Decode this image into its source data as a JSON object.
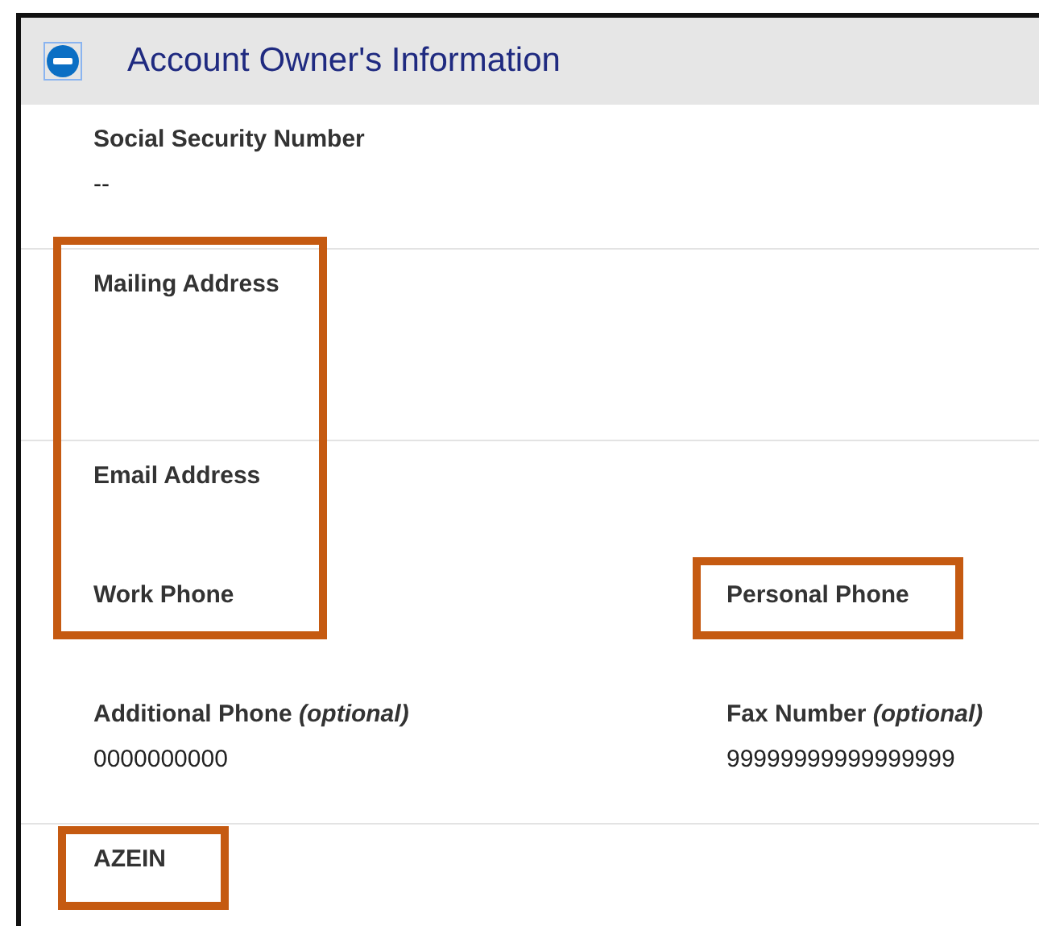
{
  "panel": {
    "title": "Account Owner's Information",
    "expanded": true
  },
  "sections": [
    {
      "rows": [
        [
          {
            "label": "Social Security Number",
            "value": "--"
          }
        ]
      ]
    },
    {
      "rows": [
        [
          {
            "label": "Mailing Address"
          }
        ]
      ],
      "tall": true
    },
    {
      "rows": [
        [
          {
            "label": "Email Address"
          }
        ],
        [
          {
            "label": "Work Phone"
          },
          {
            "label": "Personal Phone"
          }
        ],
        [
          {
            "label": "Additional Phone *(optional)*",
            "value": "0000000000"
          },
          {
            "label": "Fax Number *(optional)*",
            "value": "99999999999999999"
          }
        ]
      ]
    },
    {
      "rows": [
        [
          {
            "label": "AZEIN"
          }
        ]
      ]
    }
  ],
  "annotations": [
    {
      "kind": "highlight"
    },
    {
      "kind": "highlight"
    },
    {
      "kind": "highlight"
    }
  ]
}
